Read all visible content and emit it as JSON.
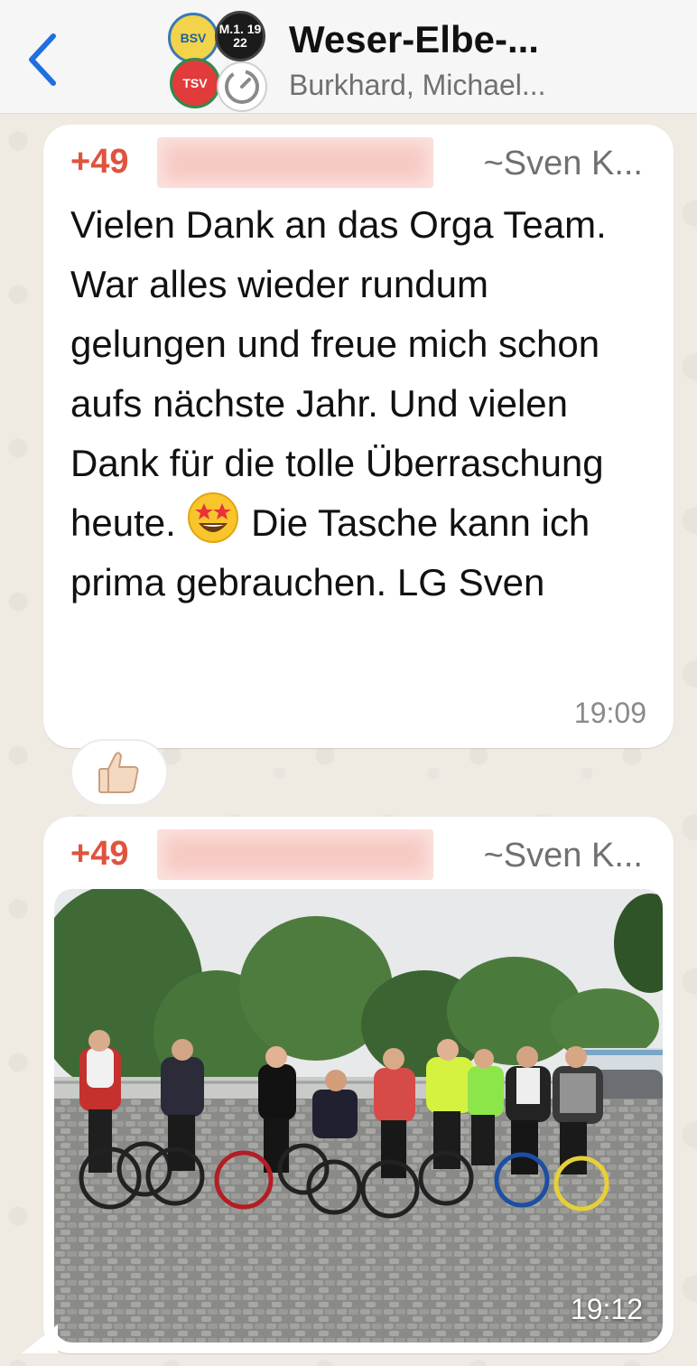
{
  "header": {
    "back_icon": "chevron-left-icon",
    "title": "Weser-Elbe-...",
    "subtitle": "Burkhard, Michael...",
    "avatar_logos": [
      "BSV",
      "M.1. 19 22",
      "TSV",
      "timer"
    ]
  },
  "messages": [
    {
      "sender_number": "+49",
      "sender_name": "~Sven K...",
      "text_before_emoji": "Vielen Dank an das Orga Team. War alles wieder rundum gelungen und freue mich schon aufs nächste Jahr. Und vielen Dank für die tolle Überraschung heute.",
      "emoji": "star-struck-emoji",
      "text_after_emoji": "Die Tasche kann ich prima gebrauchen. LG Sven",
      "time": "19:09",
      "reaction": "thumbs-up-emoji"
    },
    {
      "sender_number": "+49",
      "sender_name": "~Sven K...",
      "photo": "group-of-cyclists-photo",
      "time": "19:12"
    }
  ],
  "colors": {
    "sender_number": "#e0533f",
    "accent_blue": "#1f6fe0",
    "chat_background": "#efeae2",
    "bubble": "#ffffff"
  }
}
